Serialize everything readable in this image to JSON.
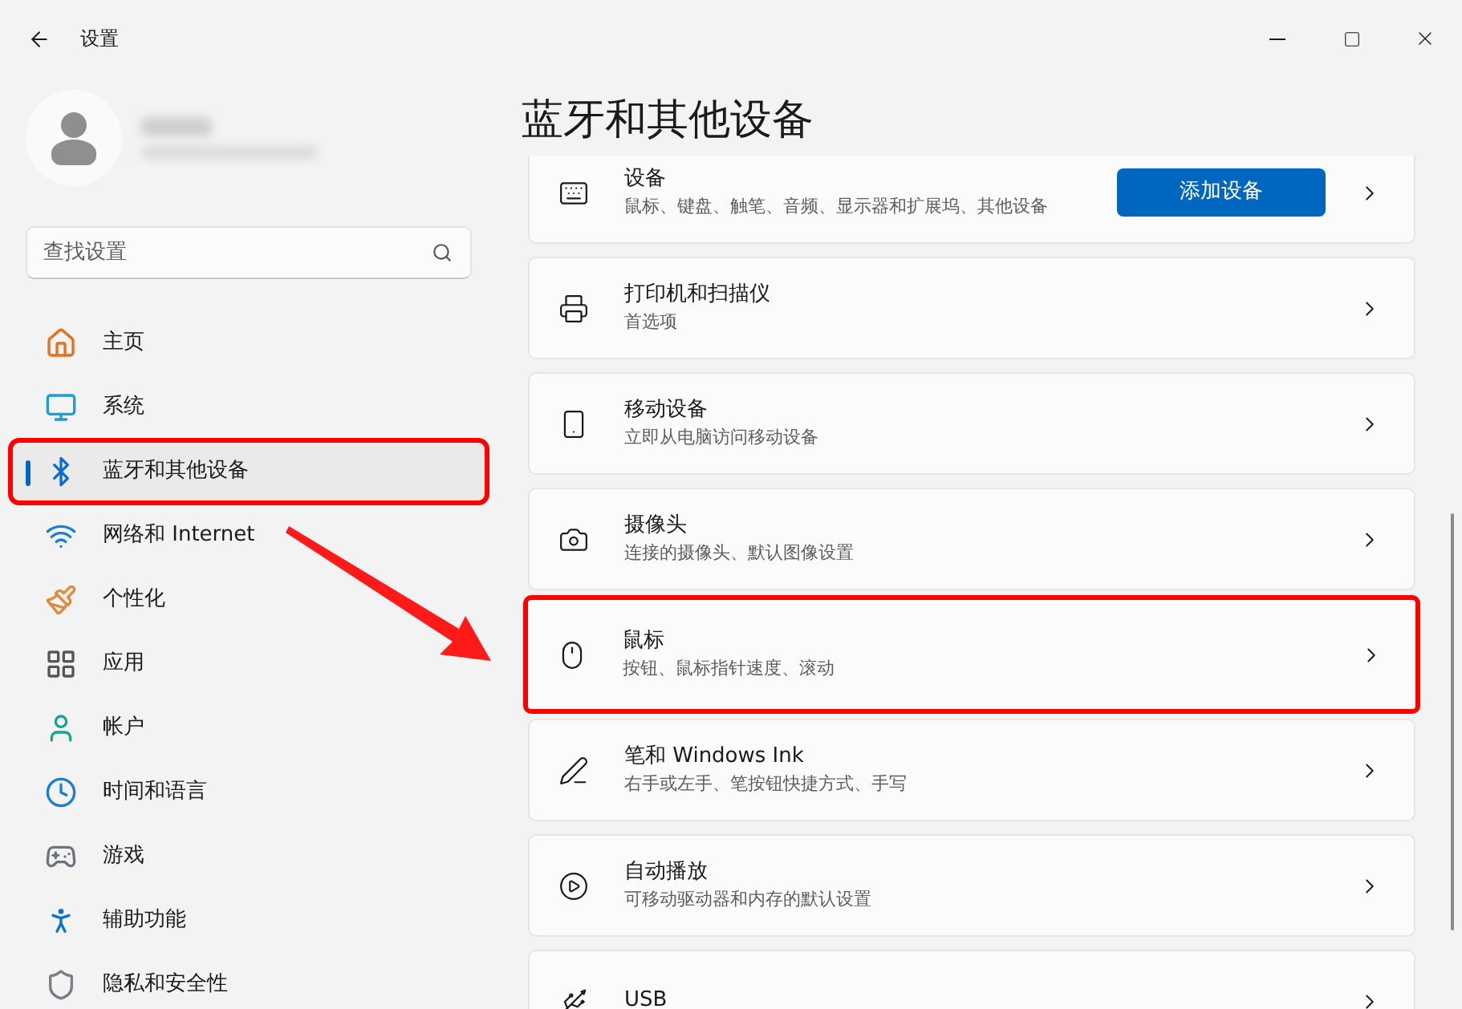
{
  "window": {
    "title": "设置"
  },
  "search": {
    "placeholder": "查找设置"
  },
  "sidebar": {
    "items": [
      {
        "label": "主页",
        "selected": false,
        "annotated": false
      },
      {
        "label": "系统",
        "selected": false,
        "annotated": false
      },
      {
        "label": "蓝牙和其他设备",
        "selected": true,
        "annotated": true
      },
      {
        "label": "网络和 Internet",
        "selected": false,
        "annotated": false
      },
      {
        "label": "个性化",
        "selected": false,
        "annotated": false
      },
      {
        "label": "应用",
        "selected": false,
        "annotated": false
      },
      {
        "label": "帐户",
        "selected": false,
        "annotated": false
      },
      {
        "label": "时间和语言",
        "selected": false,
        "annotated": false
      },
      {
        "label": "游戏",
        "selected": false,
        "annotated": false
      },
      {
        "label": "辅助功能",
        "selected": false,
        "annotated": false
      },
      {
        "label": "隐私和安全性",
        "selected": false,
        "annotated": false
      }
    ]
  },
  "page": {
    "title": "蓝牙和其他设备",
    "cards": [
      {
        "title": "设备",
        "subtitle": "鼠标、键盘、触笔、音频、显示器和扩展坞、其他设备",
        "button": "添加设备",
        "annotated": false
      },
      {
        "title": "打印机和扫描仪",
        "subtitle": "首选项",
        "annotated": false
      },
      {
        "title": "移动设备",
        "subtitle": "立即从电脑访问移动设备",
        "annotated": false
      },
      {
        "title": "摄像头",
        "subtitle": "连接的摄像头、默认图像设置",
        "annotated": false
      },
      {
        "title": "鼠标",
        "subtitle": "按钮、鼠标指针速度、滚动",
        "annotated": true
      },
      {
        "title": "笔和 Windows Ink",
        "subtitle": "右手或左手、笔按钮快捷方式、手写",
        "annotated": false
      },
      {
        "title": "自动播放",
        "subtitle": "可移动驱动器和内存的默认设置",
        "annotated": false
      },
      {
        "title": "USB",
        "annotated": false
      }
    ]
  }
}
